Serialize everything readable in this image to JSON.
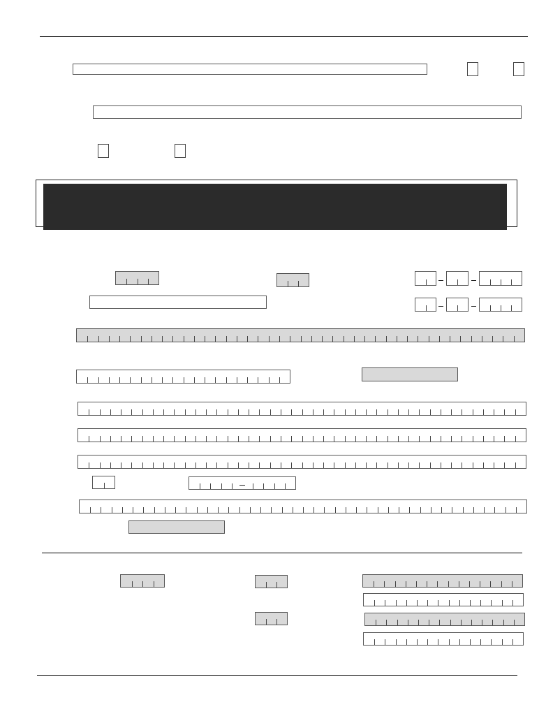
{
  "form": {
    "colors": {
      "banner": "#2b2b2b",
      "shaded_field": "#d9d9d9",
      "field_border": "#555555"
    },
    "fields": {
      "top_name": "",
      "second_line": "",
      "code_a": "",
      "code_b": "",
      "date_1_m": "",
      "date_1_d": "",
      "date_1_y": "",
      "date_2_m": "",
      "date_2_d": "",
      "date_2_y": "",
      "open_line": "",
      "long_shaded": "",
      "medium_field": "",
      "shaded_short": "",
      "line_1": "",
      "line_2": "",
      "line_3": "",
      "small_box": "",
      "split_field": "",
      "line_4": "",
      "shaded_bottom": "",
      "b_code_a": "",
      "b_code_b": "",
      "b_code_c": "",
      "b_field_1": "",
      "b_field_2": "",
      "b_field_3": "",
      "b_field_4": ""
    }
  }
}
